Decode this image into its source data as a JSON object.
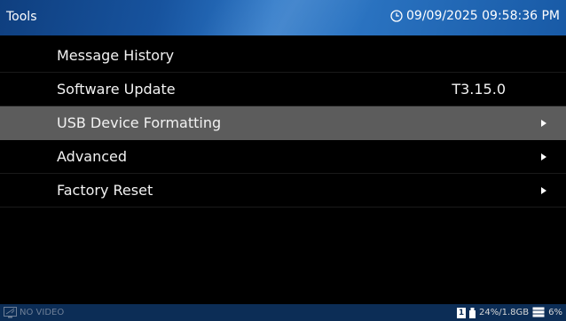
{
  "header": {
    "title": "Tools",
    "datetime": "09/09/2025 09:58:36 PM",
    "icon": "clock-icon"
  },
  "menu": {
    "items": [
      {
        "label": "Message History",
        "value": "",
        "submenu": false,
        "selected": false
      },
      {
        "label": "Software Update",
        "value": "T3.15.0",
        "submenu": false,
        "selected": false
      },
      {
        "label": "USB Device Formatting",
        "value": "",
        "submenu": true,
        "selected": true
      },
      {
        "label": "Advanced",
        "value": "",
        "submenu": true,
        "selected": false
      },
      {
        "label": "Factory Reset",
        "value": "",
        "submenu": true,
        "selected": false
      }
    ]
  },
  "status": {
    "video_status": "NO VIDEO",
    "slot_number": "1",
    "usb_usage": "24%/1.8GB",
    "disk_usage": "6%"
  },
  "colors": {
    "title_bar": "#1c5fad",
    "selected_row": "#5c5c5c",
    "status_bar": "#0c2d56"
  }
}
